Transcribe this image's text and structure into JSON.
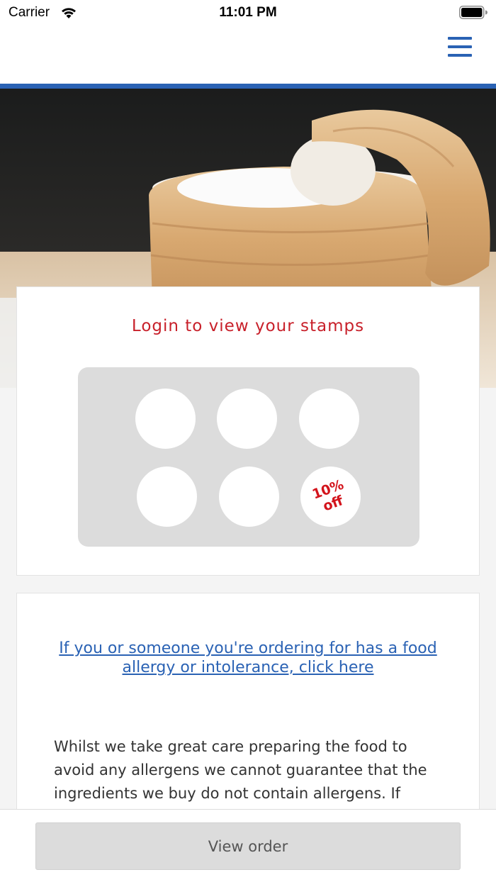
{
  "status_bar": {
    "carrier": "Carrier",
    "time": "11:01 PM",
    "icons": [
      "wifi-icon",
      "battery-icon"
    ]
  },
  "header": {
    "menu_icon": "hamburger-menu-icon",
    "accent_color": "#2a62b4"
  },
  "hero": {
    "image_subject": "bamboo steamer with buns"
  },
  "stamps": {
    "title": "Login to view your stamps",
    "title_color": "#c8202a",
    "total_slots": 6,
    "stamps_collected": 0,
    "reward_line1": "10%",
    "reward_line2": "off",
    "reward_color": "#d3141c"
  },
  "allergy": {
    "link_text": "If you or someone you're ordering for has a food allergy or intolerance, click here",
    "body_text": "Whilst we take great care preparing the food to avoid any allergens we cannot guarantee that the ingredients we buy do not contain allergens. If"
  },
  "footer": {
    "view_order_label": "View order"
  }
}
